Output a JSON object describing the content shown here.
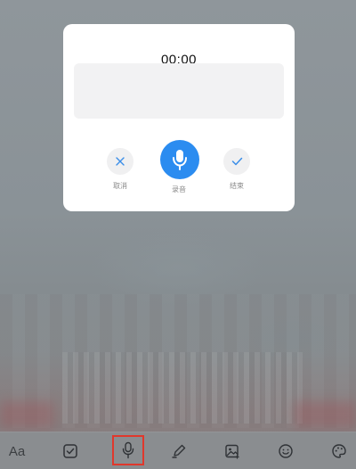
{
  "dialog": {
    "timer": "00:00",
    "transcript_text": "",
    "controls": {
      "cancel_label": "取消",
      "record_label": "录音",
      "finish_label": "结束"
    }
  },
  "toolbar": {
    "text_style_label": "Aa",
    "items": [
      {
        "name": "text-style",
        "icon": "text-format-icon"
      },
      {
        "name": "checklist",
        "icon": "checkbox-icon"
      },
      {
        "name": "voice",
        "icon": "microphone-icon",
        "selected": true
      },
      {
        "name": "handwriting",
        "icon": "pen-icon"
      },
      {
        "name": "image",
        "icon": "image-icon"
      },
      {
        "name": "emoji",
        "icon": "smiley-icon"
      },
      {
        "name": "theme",
        "icon": "palette-icon"
      }
    ]
  },
  "colors": {
    "accent": "#2b8cf0",
    "highlight_border": "#e0382c",
    "overlay": "#8e9499",
    "dialog_bg": "#ffffff",
    "button_bg": "#f0f0f1"
  }
}
